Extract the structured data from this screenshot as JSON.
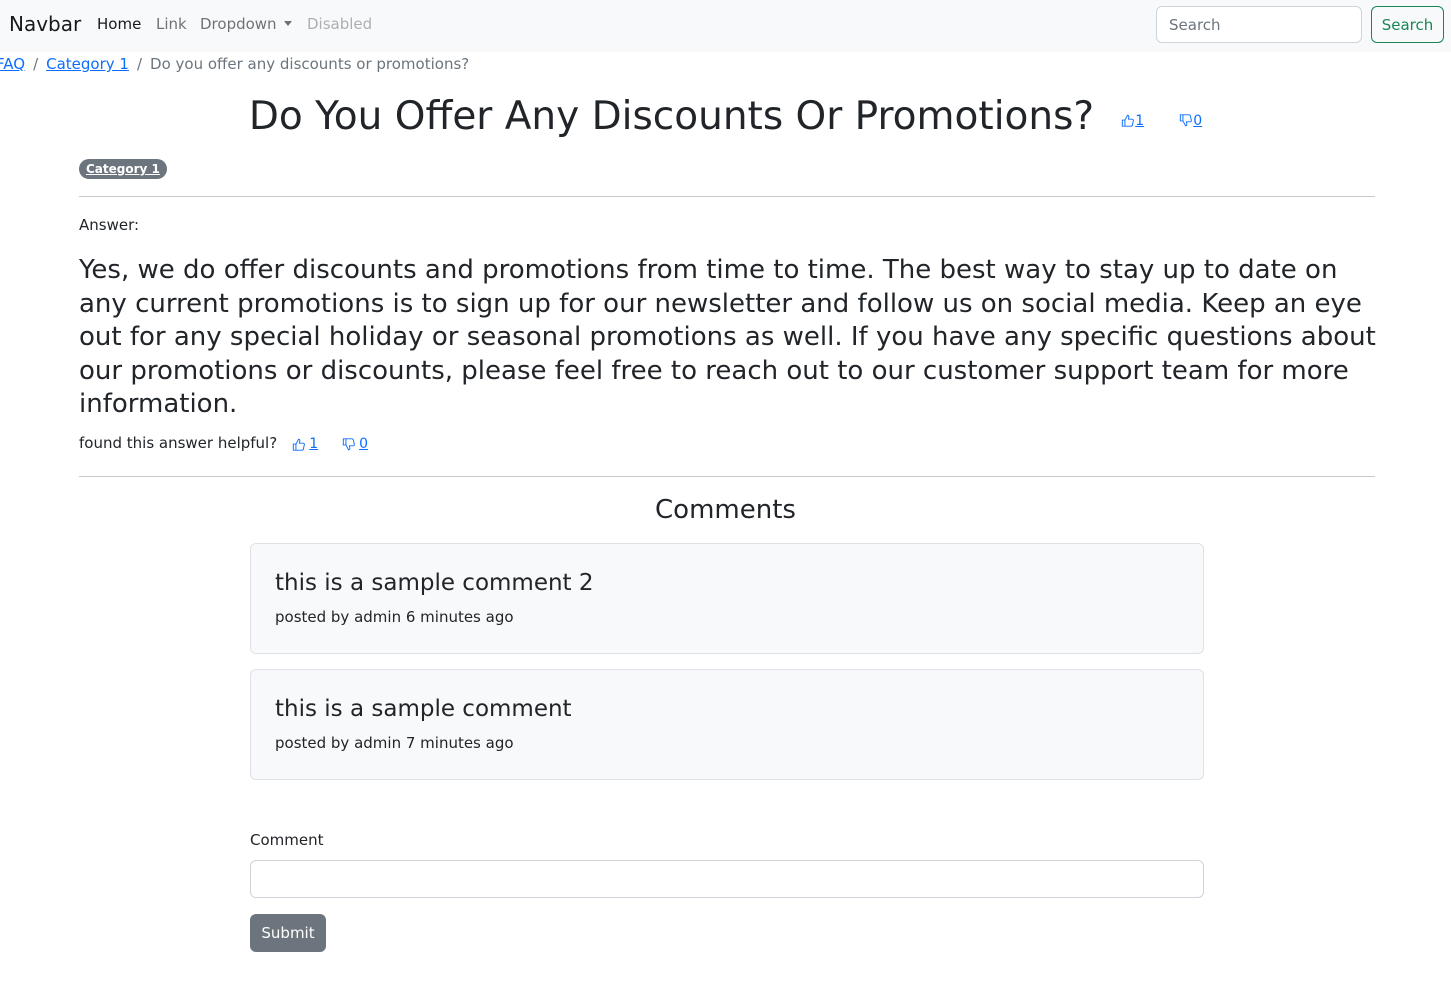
{
  "navbar": {
    "brand": "Navbar",
    "links": [
      {
        "label": "Home"
      },
      {
        "label": "Link"
      },
      {
        "label": "Dropdown"
      },
      {
        "label": "Disabled"
      }
    ],
    "search_placeholder": "Search",
    "search_button": "Search"
  },
  "breadcrumb": {
    "items": [
      "FAQ",
      "Category 1"
    ],
    "separator": "/",
    "current": "Do you offer any discounts or promotions?"
  },
  "question": {
    "title": "Do You Offer Any Discounts Or Promotions?",
    "upvotes": "1",
    "downvotes": "0",
    "category_badge": "Category 1"
  },
  "answer": {
    "label": "Answer:",
    "text": "Yes, we do offer discounts and promotions from time to time. The best way to stay up to date on any current promotions is to sign up for our newsletter and follow us on social media. Keep an eye out for any special holiday or seasonal promotions as well. If you have any specific questions about our promotions or discounts, please feel free to reach out to our customer support team for more information.",
    "helpful_prompt": "found this answer helpful?",
    "upvotes": "1",
    "downvotes": "0"
  },
  "comments": {
    "heading": "Comments",
    "items": [
      {
        "text": "this is a sample comment 2",
        "meta": "posted by admin 6 minutes ago"
      },
      {
        "text": "this is a sample comment",
        "meta": "posted by admin 7 minutes ago"
      }
    ]
  },
  "comment_form": {
    "label": "Comment",
    "value": "",
    "submit_label": "Submit"
  },
  "colors": {
    "link": "#0d6efd",
    "success": "#198754",
    "secondary": "#6c757d",
    "navbar_bg": "#f8f9fa"
  },
  "icons": {
    "upvote": "thumbs-up-icon",
    "downvote": "thumbs-down-icon",
    "dropdown": "caret-down-icon"
  }
}
